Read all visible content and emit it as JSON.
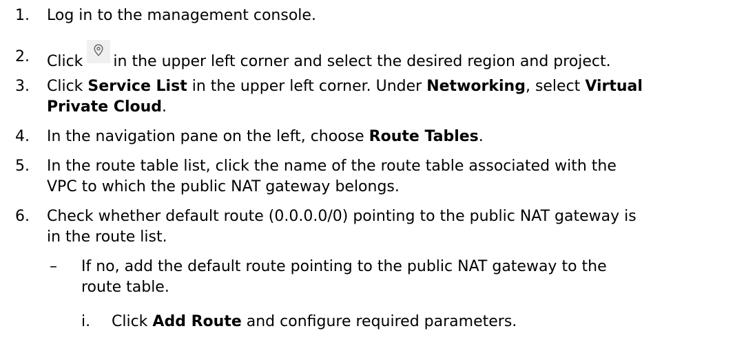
{
  "steps": [
    {
      "num": "1.",
      "text": "Log in to the management console."
    },
    {
      "num": "2.",
      "pre": "Click",
      "icon": "location-pin-icon",
      "post": "in the upper left corner and select the desired region and project."
    },
    {
      "num": "3.",
      "t1": "Click ",
      "b1": "Service List",
      "t2": " in the upper left corner. Under ",
      "b2": "Networking",
      "t3": ", select ",
      "b3": "Virtual",
      "b3b": "Private Cloud",
      "t4": "."
    },
    {
      "num": "4.",
      "t1": "In the navigation pane on the left, choose ",
      "b1": "Route Tables",
      "t2": "."
    },
    {
      "num": "5.",
      "line1": "In the route table list, click the name of the route table associated with the",
      "line2": "VPC to which the public NAT gateway belongs."
    },
    {
      "num": "6.",
      "line1": "Check whether default route (0.0.0.0/0) pointing to the public NAT gateway is",
      "line2": "in the route list."
    }
  ],
  "sub": {
    "dash": "–",
    "line1": "If no, add the default route pointing to the public NAT gateway to the",
    "line2": "route table.",
    "item": {
      "num": "i.",
      "t1": "Click ",
      "b1": "Add Route",
      "t2": " and configure required parameters."
    }
  }
}
